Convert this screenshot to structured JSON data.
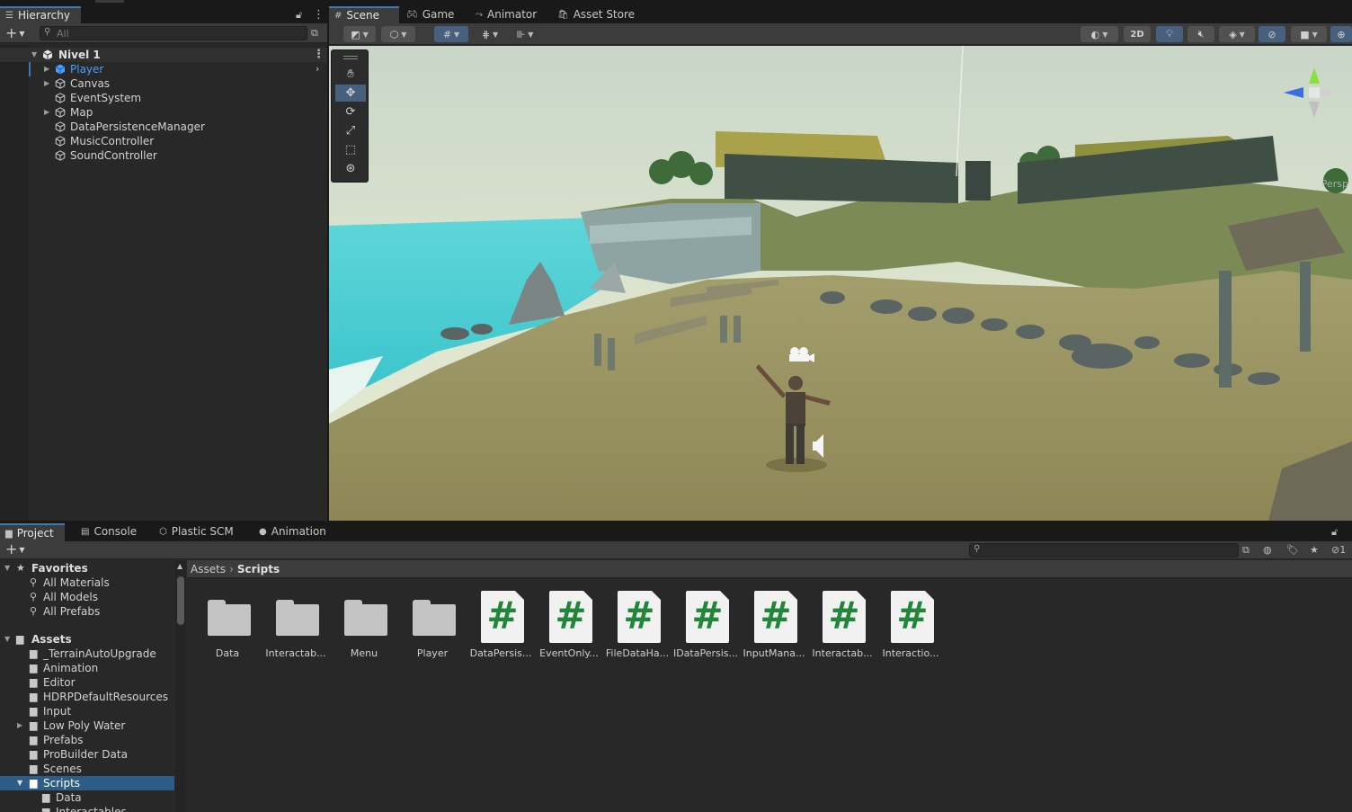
{
  "hierarchy": {
    "tab_label": "Hierarchy",
    "search_placeholder": "All",
    "scene_name": "Nivel 1",
    "items": [
      {
        "label": "Player",
        "expandable": true,
        "selected": true
      },
      {
        "label": "Canvas",
        "expandable": true
      },
      {
        "label": "EventSystem",
        "expandable": false
      },
      {
        "label": "Map",
        "expandable": true
      },
      {
        "label": "DataPersistenceManager",
        "expandable": false
      },
      {
        "label": "MusicController",
        "expandable": false
      },
      {
        "label": "SoundController",
        "expandable": false
      }
    ]
  },
  "scene_tabs": [
    {
      "label": "Scene",
      "icon": "grid-icon",
      "active": true
    },
    {
      "label": "Game",
      "icon": "gamepad-icon"
    },
    {
      "label": "Animator",
      "icon": "animator-icon"
    },
    {
      "label": "Asset Store",
      "icon": "bag-icon"
    }
  ],
  "scene_toolbar": {
    "mode_2d_label": "2D",
    "persp_label": "Persp"
  },
  "tools": [
    "hand-tool",
    "move-tool",
    "rotate-tool",
    "scale-tool",
    "rect-tool",
    "transform-tool"
  ],
  "project": {
    "tabs": [
      {
        "label": "Project",
        "icon": "folder-icon",
        "active": true
      },
      {
        "label": "Console",
        "icon": "console-icon"
      },
      {
        "label": "Plastic SCM",
        "icon": "plastic-icon"
      },
      {
        "label": "Animation",
        "icon": "clock-icon"
      }
    ],
    "favorites_label": "Favorites",
    "favorites": [
      "All Materials",
      "All Models",
      "All Prefabs"
    ],
    "assets_label": "Assets",
    "folders": [
      {
        "label": "_TerrainAutoUpgrade"
      },
      {
        "label": "Animation"
      },
      {
        "label": "Editor"
      },
      {
        "label": "HDRPDefaultResources"
      },
      {
        "label": "Input"
      },
      {
        "label": "Low Poly Water",
        "expandable": true
      },
      {
        "label": "Prefabs"
      },
      {
        "label": "ProBuilder Data"
      },
      {
        "label": "Scenes"
      },
      {
        "label": "Scripts",
        "selected": true,
        "expanded": true
      }
    ],
    "subfolders": [
      "Data",
      "Interactables"
    ],
    "breadcrumb": [
      "Assets",
      "Scripts"
    ],
    "grid_items": [
      {
        "name": "Data",
        "kind": "folder"
      },
      {
        "name": "Interactab...",
        "kind": "folder"
      },
      {
        "name": "Menu",
        "kind": "folder"
      },
      {
        "name": "Player",
        "kind": "folder"
      },
      {
        "name": "DataPersis...",
        "kind": "script"
      },
      {
        "name": "EventOnly...",
        "kind": "script"
      },
      {
        "name": "FileDataHa...",
        "kind": "script"
      },
      {
        "name": "IDataPersis...",
        "kind": "script"
      },
      {
        "name": "InputMana...",
        "kind": "script"
      },
      {
        "name": "Interactab...",
        "kind": "script"
      },
      {
        "name": "Interactio...",
        "kind": "script"
      }
    ],
    "hidden_count": "1"
  },
  "colors": {
    "accent": "#3a79bb",
    "selection": "#2c5d87",
    "script_green": "#21863a",
    "player_blue": "#4a9eff"
  }
}
